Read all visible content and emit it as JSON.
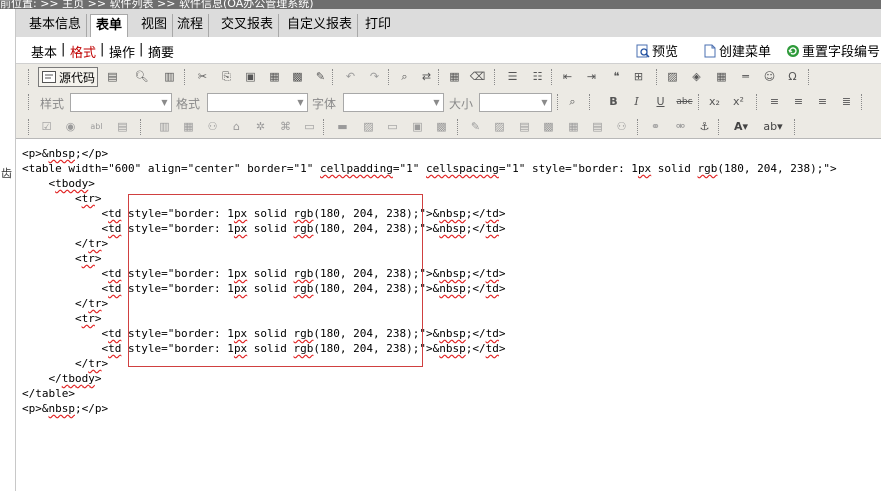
{
  "topbar": {
    "text": "前位置: >> 主页 >> 软件列表 >> 软件信息(OA办公管理系统)"
  },
  "left_strip": {
    "glyph": "齿"
  },
  "tabs": [
    {
      "label": "基本信息",
      "active": false
    },
    {
      "label": "表单",
      "active": true
    },
    {
      "label": "视图",
      "active": false
    },
    {
      "label": "流程",
      "active": false
    },
    {
      "label": "交叉报表",
      "active": false
    },
    {
      "label": "自定义报表",
      "active": false
    },
    {
      "label": "打印",
      "active": false
    }
  ],
  "subbar": {
    "items": [
      {
        "label": "基本",
        "active": false
      },
      {
        "label": "格式",
        "active": true
      },
      {
        "label": "操作",
        "active": false
      },
      {
        "label": "摘要",
        "active": false
      }
    ],
    "separator": "|",
    "actions": [
      {
        "label": "预览",
        "icon": "preview-icon"
      },
      {
        "label": "创建菜单",
        "icon": "document-icon"
      },
      {
        "label": "重置字段编号",
        "icon": "refresh-icon"
      }
    ]
  },
  "editor_toolbar": {
    "source_button": "源代码",
    "combos": [
      {
        "label": "样式",
        "value": ""
      },
      {
        "label": "格式",
        "value": ""
      },
      {
        "label": "字体",
        "value": ""
      },
      {
        "label": "大小",
        "value": ""
      }
    ],
    "colors": {
      "bar": "#eceae4",
      "accent": "#c00000",
      "selection": "#d04040"
    }
  },
  "code": {
    "lines": [
      "<p>&nbsp;</p>",
      "<table width=\"600\" align=\"center\" border=\"1\" cellpadding=\"1\" cellspacing=\"1\" style=\"border: 1px solid rgb(180, 204, 238);\">",
      "    <tbody>",
      "        <tr>",
      "            <td style=\"border: 1px solid rgb(180, 204, 238);\">&nbsp;</td>",
      "            <td style=\"border: 1px solid rgb(180, 204, 238);\">&nbsp;</td>",
      "        </tr>",
      "        <tr>",
      "            <td style=\"border: 1px solid rgb(180, 204, 238);\">&nbsp;</td>",
      "            <td style=\"border: 1px solid rgb(180, 204, 238);\">&nbsp;</td>",
      "        </tr>",
      "        <tr>",
      "            <td style=\"border: 1px solid rgb(180, 204, 238);\">&nbsp;</td>",
      "            <td style=\"border: 1px solid rgb(180, 204, 238);\">&nbsp;</td>",
      "        </tr>",
      "    </tbody>",
      "</table>",
      "<p>&nbsp;</p>"
    ]
  }
}
